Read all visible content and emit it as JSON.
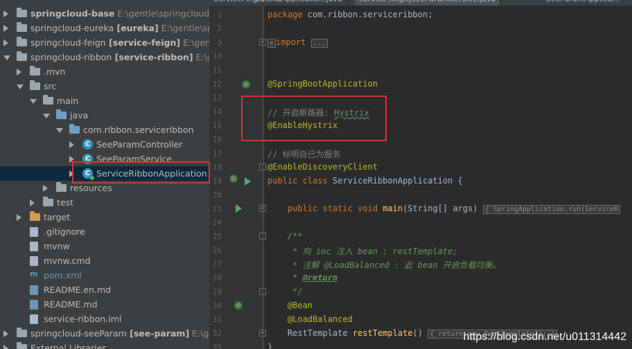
{
  "tabs": [
    "ServiceFeign...",
    "EurekaApplication.java",
    "service-feign|SeeParamService.java",
    "SeeParamApplica..."
  ],
  "tree": {
    "header": "Project",
    "items": [
      {
        "label": "springcloud-base",
        "module": "",
        "path": "E:\\gentle\\springcloud-ba",
        "depth": 0,
        "icon": "module-folder-icon",
        "arrow": "right",
        "bold": true
      },
      {
        "label": "springcloud-eureka",
        "module": "[eureka]",
        "path": "E:\\gentle\\sprir",
        "depth": 0,
        "icon": "module-folder-icon",
        "arrow": "right",
        "bold": false
      },
      {
        "label": "springcloud-feign",
        "module": "[service-feign]",
        "path": "E:\\gentle\\",
        "depth": 0,
        "icon": "module-folder-icon",
        "arrow": "right",
        "bold": false
      },
      {
        "label": "springcloud-ribbon",
        "module": "[service-ribbon]",
        "path": "E:\\gen",
        "depth": 0,
        "icon": "module-folder-icon",
        "arrow": "down",
        "bold": false
      },
      {
        "label": ".mvn",
        "module": "",
        "path": "",
        "depth": 1,
        "icon": "folder-icon",
        "arrow": "right"
      },
      {
        "label": "src",
        "module": "",
        "path": "",
        "depth": 1,
        "icon": "folder-icon",
        "arrow": "down"
      },
      {
        "label": "main",
        "module": "",
        "path": "",
        "depth": 2,
        "icon": "folder-icon",
        "arrow": "down"
      },
      {
        "label": "java",
        "module": "",
        "path": "",
        "depth": 3,
        "icon": "source-folder-icon",
        "arrow": "down"
      },
      {
        "label": "com.ribbon.serviceribbon",
        "module": "",
        "path": "",
        "depth": 4,
        "icon": "package-icon",
        "arrow": "down"
      },
      {
        "label": "SeeParamController",
        "module": "",
        "path": "",
        "depth": 5,
        "icon": "class-icon",
        "arrow": "right"
      },
      {
        "label": "SeeParamService",
        "module": "",
        "path": "",
        "depth": 5,
        "icon": "class-icon",
        "arrow": "right"
      },
      {
        "label": "ServiceRibbonApplication",
        "module": "",
        "path": "",
        "depth": 5,
        "icon": "class-run-icon",
        "arrow": "right",
        "selected": true
      },
      {
        "label": "resources",
        "module": "",
        "path": "",
        "depth": 3,
        "icon": "resources-folder-icon",
        "arrow": "right"
      },
      {
        "label": "test",
        "module": "",
        "path": "",
        "depth": 2,
        "icon": "folder-icon",
        "arrow": "right"
      },
      {
        "label": "target",
        "module": "",
        "path": "",
        "depth": 1,
        "icon": "excluded-folder-icon",
        "arrow": "right"
      },
      {
        "label": ".gitignore",
        "module": "",
        "path": "",
        "depth": 1,
        "icon": "file-icon",
        "arrow": ""
      },
      {
        "label": "mvnw",
        "module": "",
        "path": "",
        "depth": 1,
        "icon": "file-icon",
        "arrow": ""
      },
      {
        "label": "mvnw.cmd",
        "module": "",
        "path": "",
        "depth": 1,
        "icon": "file-icon",
        "arrow": ""
      },
      {
        "label": "pom.xml",
        "module": "",
        "path": "",
        "depth": 1,
        "icon": "maven-icon",
        "arrow": "",
        "style": "blue"
      },
      {
        "label": "README.en.md",
        "module": "",
        "path": "",
        "depth": 1,
        "icon": "markdown-icon",
        "arrow": ""
      },
      {
        "label": "README.md",
        "module": "",
        "path": "",
        "depth": 1,
        "icon": "markdown-icon",
        "arrow": ""
      },
      {
        "label": "service-ribbon.iml",
        "module": "",
        "path": "",
        "depth": 1,
        "icon": "file-icon",
        "arrow": ""
      },
      {
        "label": "springcloud-seeParam",
        "module": "[see-param]",
        "path": "E:\\gent",
        "depth": 0,
        "icon": "module-folder-icon",
        "arrow": "right"
      },
      {
        "label": "External Libraries",
        "module": "",
        "path": "",
        "depth": 0,
        "icon": "library-icon",
        "arrow": "right"
      }
    ]
  },
  "editor": {
    "lines": [
      {
        "n": "1",
        "parts": [
          [
            "kw",
            "package "
          ],
          [
            "t",
            "com.ribbon.serviceribbon;"
          ]
        ]
      },
      {
        "n": "2",
        "parts": []
      },
      {
        "n": "3",
        "parts": [
          [
            "fold",
            "+"
          ],
          [
            "kw",
            "import "
          ],
          [
            "fold",
            "..."
          ]
        ]
      },
      {
        "n": "10",
        "parts": []
      },
      {
        "n": "11",
        "parts": []
      },
      {
        "n": "12",
        "parts": [
          [
            "an",
            "@SpringBootApplication"
          ]
        ]
      },
      {
        "n": "13",
        "parts": []
      },
      {
        "n": "14",
        "parts": [
          [
            "cm",
            "// 开启断路器: "
          ],
          [
            "sq",
            "Hystrix"
          ]
        ]
      },
      {
        "n": "15",
        "parts": [
          [
            "an",
            "@EnableHystrix"
          ]
        ]
      },
      {
        "n": "16",
        "parts": []
      },
      {
        "n": "17",
        "parts": [
          [
            "cm",
            "// 标明自已为服务"
          ]
        ]
      },
      {
        "n": "18",
        "parts": [
          [
            "an",
            "@EnableDiscoveryClient"
          ]
        ]
      },
      {
        "n": "19",
        "parts": [
          [
            "kw",
            "public class "
          ],
          [
            "t",
            "ServiceRibbonApplication {"
          ]
        ]
      },
      {
        "n": "20",
        "parts": []
      },
      {
        "n": "21",
        "parts": [
          [
            "t",
            "    "
          ],
          [
            "kw",
            "public static void "
          ],
          [
            "fn",
            "main"
          ],
          [
            "t",
            "(String[] args) "
          ],
          [
            "fold",
            "{ SpringApplication.run(ServiceR"
          ]
        ]
      },
      {
        "n": "24",
        "parts": []
      },
      {
        "n": "25",
        "parts": [
          [
            "t",
            "    "
          ],
          [
            "jd",
            "/**"
          ]
        ]
      },
      {
        "n": "26",
        "parts": [
          [
            "t",
            "     "
          ],
          [
            "jd",
            "* 向 ioc 注入 bean : restTemplate;"
          ]
        ]
      },
      {
        "n": "27",
        "parts": [
          [
            "t",
            "     "
          ],
          [
            "jd",
            "* 注解 @LoadBalanced : 此 bean 开启负载均衡。"
          ]
        ]
      },
      {
        "n": "28",
        "parts": [
          [
            "t",
            "     "
          ],
          [
            "jd",
            "* "
          ],
          [
            "jdt",
            "@return"
          ]
        ]
      },
      {
        "n": "29",
        "parts": [
          [
            "t",
            "     "
          ],
          [
            "jd",
            "*/"
          ]
        ]
      },
      {
        "n": "30",
        "parts": [
          [
            "t",
            "    "
          ],
          [
            "an",
            "@Bean"
          ]
        ]
      },
      {
        "n": "31",
        "parts": [
          [
            "t",
            "    "
          ],
          [
            "an",
            "@LoadBalanced"
          ]
        ]
      },
      {
        "n": "32",
        "parts": [
          [
            "t",
            "    RestTemplate "
          ],
          [
            "fn",
            "restTemplate"
          ],
          [
            "t",
            "() "
          ],
          [
            "fold",
            "{ return new RestTemplate(); }"
          ]
        ]
      },
      {
        "n": "35",
        "parts": [
          [
            "t",
            "}"
          ]
        ]
      }
    ]
  },
  "watermark": "https://blog.csdn.net/u011314442",
  "colors": {
    "highlight_box": "#e03030",
    "selection": "#0d293e",
    "keyword": "#cc7832",
    "annotation": "#bbb529"
  }
}
